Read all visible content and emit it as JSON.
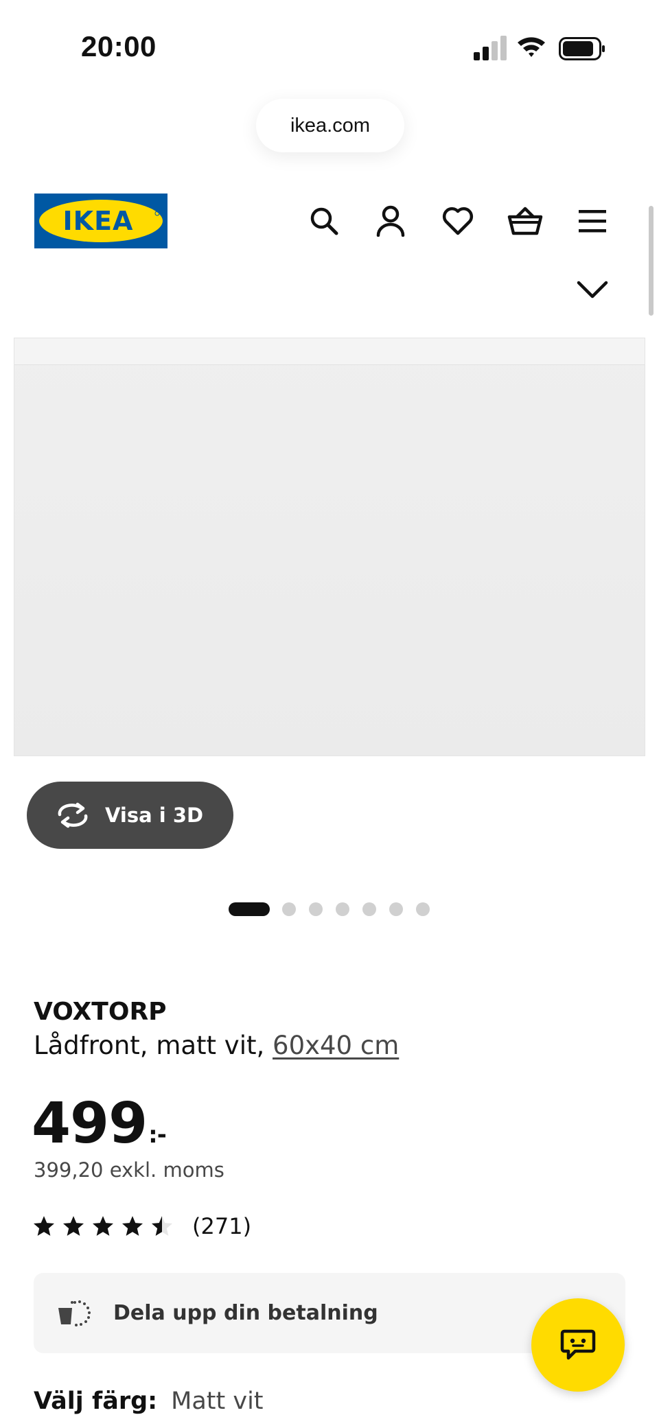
{
  "status_bar": {
    "time": "20:00"
  },
  "browser": {
    "url": "ikea.com"
  },
  "brand": {
    "logo_text": "IKEA",
    "blue": "#0058a3",
    "yellow": "#ffdb00"
  },
  "header_icons": [
    "search-icon",
    "user-icon",
    "heart-icon",
    "basket-icon",
    "menu-icon"
  ],
  "gallery": {
    "view_3d_label": "Visa i 3D",
    "total_images": 7,
    "active_index": 0
  },
  "product": {
    "name": "VOXTORP",
    "description": "Lådfront, matt vit,",
    "size_link": "60x40 cm",
    "price": "499",
    "price_suffix": ":-",
    "price_ex_vat": "399,20 exkl. moms",
    "rating": 4.5,
    "review_count": "(271)"
  },
  "payment": {
    "label": "Dela upp din betalning"
  },
  "color": {
    "label": "Välj färg:",
    "value": "Matt vit"
  }
}
